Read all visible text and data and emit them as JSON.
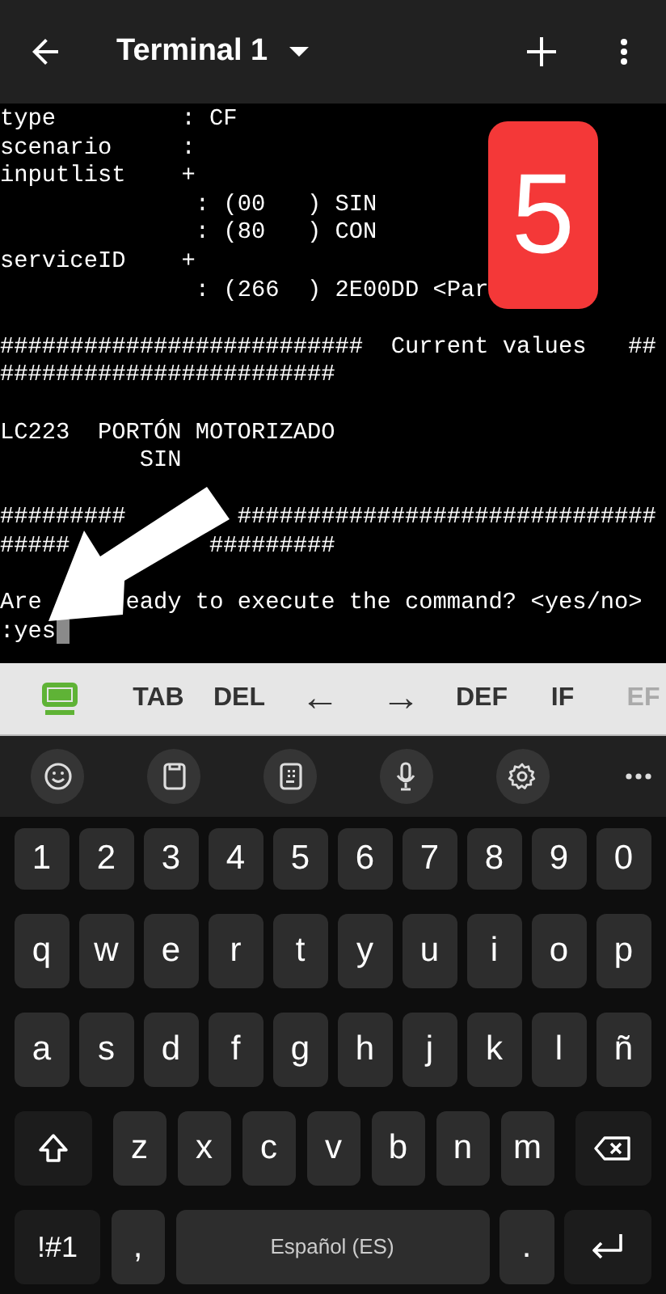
{
  "app_bar": {
    "title": "Terminal 1"
  },
  "terminal": {
    "lines": [
      {
        "kind": "text",
        "segments": [
          "type         : CF"
        ]
      },
      {
        "kind": "text",
        "segments": [
          "scenario     :"
        ]
      },
      {
        "kind": "text",
        "segments": [
          "inputlist    +"
        ]
      },
      {
        "kind": "text",
        "segments": [
          "              : (00   ) SIN"
        ]
      },
      {
        "kind": "text",
        "segments": [
          "              : (80   ) CON"
        ]
      },
      {
        "kind": "text",
        "segments": [
          "serviceID    +"
        ]
      },
      {
        "kind": "text",
        "segments": [
          "              : (266  ) 2E00DD <Par"
        ]
      },
      {
        "kind": "blank"
      },
      {
        "kind": "text",
        "segments": [
          "##########################",
          "  Current values",
          "   ##"
        ]
      },
      {
        "kind": "text",
        "segments": [
          "########################"
        ]
      },
      {
        "kind": "blank"
      },
      {
        "kind": "text",
        "segments": [
          "LC223  PORTÓN MOTORIZADO"
        ]
      },
      {
        "kind": "text",
        "segments": [
          "          SIN"
        ]
      },
      {
        "kind": "blank"
      },
      {
        "kind": "text",
        "segments": [
          "#########",
          "        ##############################"
        ]
      },
      {
        "kind": "text",
        "segments": [
          "#####",
          "          #########"
        ]
      },
      {
        "kind": "blank"
      },
      {
        "kind": "text",
        "segments": [
          "Are",
          "      eady to execute the command? <yes/no>"
        ]
      },
      {
        "kind": "text",
        "segments": [
          ":yes"
        ]
      }
    ],
    "cursor": true
  },
  "badge": "5",
  "extra_keys": [
    {
      "kind": "toggle"
    },
    {
      "kind": "text",
      "label": "TAB",
      "dimmed": false
    },
    {
      "kind": "text",
      "label": "DEL",
      "dimmed": false
    },
    {
      "kind": "text",
      "label": "←",
      "dimmed": false
    },
    {
      "kind": "text",
      "label": "→",
      "dimmed": false
    },
    {
      "kind": "text",
      "label": "DEF",
      "dimmed": false
    },
    {
      "kind": "text",
      "label": "IF",
      "dimmed": false
    },
    {
      "kind": "text",
      "label": "EF",
      "dimmed": true
    }
  ],
  "keyboard_toolbar": [
    {
      "kind": "emoji"
    },
    {
      "kind": "clipboard"
    },
    {
      "kind": "keypad"
    },
    {
      "kind": "mic"
    },
    {
      "kind": "settings"
    },
    {
      "kind": "more"
    }
  ],
  "keyboard": {
    "rows": [
      {
        "keys": [
          {
            "kind": "char",
            "label": "1"
          },
          {
            "kind": "char",
            "label": "2"
          },
          {
            "kind": "char",
            "label": "3"
          },
          {
            "kind": "char",
            "label": "4"
          },
          {
            "kind": "char",
            "label": "5"
          },
          {
            "kind": "char",
            "label": "6"
          },
          {
            "kind": "char",
            "label": "7"
          },
          {
            "kind": "char",
            "label": "8"
          },
          {
            "kind": "char",
            "label": "9"
          },
          {
            "kind": "char",
            "label": "0"
          }
        ]
      },
      {
        "keys": [
          {
            "kind": "char",
            "label": "q"
          },
          {
            "kind": "char",
            "label": "w"
          },
          {
            "kind": "char",
            "label": "e"
          },
          {
            "kind": "char",
            "label": "r"
          },
          {
            "kind": "char",
            "label": "t"
          },
          {
            "kind": "char",
            "label": "y"
          },
          {
            "kind": "char",
            "label": "u"
          },
          {
            "kind": "char",
            "label": "i"
          },
          {
            "kind": "char",
            "label": "o"
          },
          {
            "kind": "char",
            "label": "p"
          }
        ]
      },
      {
        "keys": [
          {
            "kind": "char",
            "label": "a"
          },
          {
            "kind": "char",
            "label": "s"
          },
          {
            "kind": "char",
            "label": "d"
          },
          {
            "kind": "char",
            "label": "f"
          },
          {
            "kind": "char",
            "label": "g"
          },
          {
            "kind": "char",
            "label": "h"
          },
          {
            "kind": "char",
            "label": "j"
          },
          {
            "kind": "char",
            "label": "k"
          },
          {
            "kind": "char",
            "label": "l"
          },
          {
            "kind": "char",
            "label": "ñ"
          }
        ]
      },
      {
        "keys": [
          {
            "kind": "shift"
          },
          {
            "kind": "char",
            "label": "z"
          },
          {
            "kind": "char",
            "label": "x"
          },
          {
            "kind": "char",
            "label": "c"
          },
          {
            "kind": "char",
            "label": "v"
          },
          {
            "kind": "char",
            "label": "b"
          },
          {
            "kind": "char",
            "label": "n"
          },
          {
            "kind": "char",
            "label": "m"
          },
          {
            "kind": "backspace"
          }
        ]
      },
      {
        "keys": [
          {
            "kind": "symbols",
            "label": "!#1"
          },
          {
            "kind": "punct",
            "label": ","
          },
          {
            "kind": "space",
            "label": "Español (ES)"
          },
          {
            "kind": "punct",
            "label": "."
          },
          {
            "kind": "enter"
          }
        ]
      }
    ]
  }
}
